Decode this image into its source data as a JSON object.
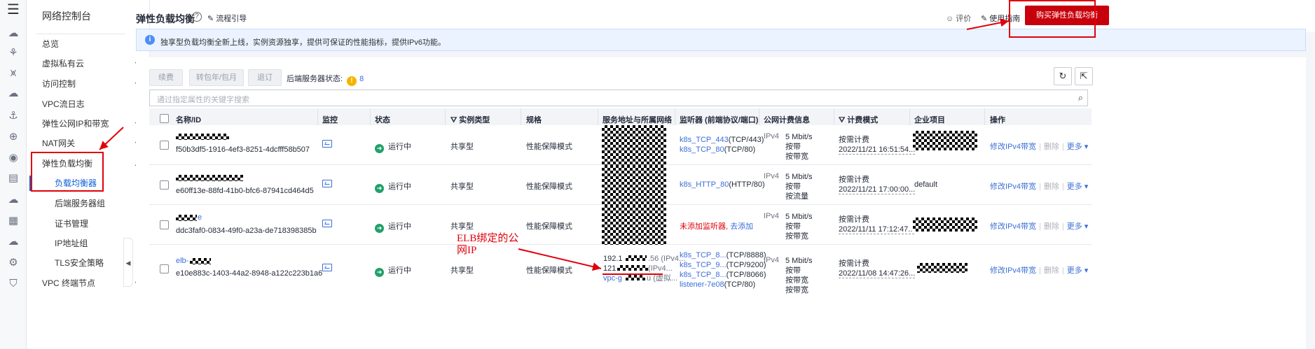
{
  "rail": {
    "icons": [
      "menu-icon",
      "cloud-icon",
      "cluster-icon",
      "bridge-icon",
      "cloud-network-icon",
      "anchor-icon",
      "globe-icon",
      "target-icon",
      "document-icon",
      "cloud-outline-icon",
      "server-icon",
      "cloud-link-icon",
      "gear-box-icon"
    ]
  },
  "sidebar": {
    "title": "网络控制台",
    "items": [
      {
        "label": "总览",
        "caret": ""
      },
      {
        "label": "虚拟私有云",
        "caret": "▼"
      },
      {
        "label": "访问控制",
        "caret": "▼"
      },
      {
        "label": "VPC流日志",
        "caret": ""
      },
      {
        "label": "弹性公网IP和带宽",
        "caret": "▼"
      },
      {
        "label": "NAT网关",
        "caret": "▼"
      },
      {
        "label": "弹性负载均衡",
        "caret": "▲"
      }
    ],
    "subitems": [
      "负载均衡器",
      "后端服务器组",
      "证书管理",
      "IP地址组",
      "TLS安全策略"
    ],
    "bottom_item": {
      "label": "VPC 终端节点",
      "caret": "▼"
    },
    "collapse": "◀"
  },
  "header": {
    "title": "弹性负载均衡",
    "help": "?",
    "flow_guide": "流程引导",
    "rate": "评价",
    "usage_guide": "使用指南",
    "buy_button": "购买弹性负载均衡"
  },
  "notice": {
    "icon": "i",
    "text": "独享型负载均衡全新上线，实例资源独享，提供可保证的性能指标，提供IPv6功能。"
  },
  "toolbar": {
    "renew": "续费",
    "to_monthly": "转包年/包月",
    "unsubscribe": "退订",
    "backend_status_label": "后端服务器状态:",
    "backend_status_icon": "!",
    "backend_status_count": "8",
    "refresh_icon": "↻",
    "export_icon": "⇱"
  },
  "search": {
    "placeholder": "通过指定属性的关键字搜索",
    "icon": "⌕"
  },
  "table": {
    "headers": {
      "name": "名称/ID",
      "monitor": "监控",
      "status": "状态",
      "instance_type": "实例类型",
      "spec": "规格",
      "service_addr": "服务地址与所属网络",
      "listener": "监听器 (前端协议/端口)",
      "billing_info": "公网计费信息",
      "billing_mode": "计费模式",
      "enterprise_project": "企业项目",
      "operation": "操作"
    },
    "rows": [
      {
        "name_suffix": "",
        "id": "f50b3df5-1916-4ef3-8251-4dcfff58b507",
        "status": "运行中",
        "type": "共享型",
        "spec": "性能保障模式",
        "addr": [
          "",
          "",
          ""
        ],
        "listeners": [
          {
            "name": "k8s_TCP_443",
            "proto": "(TCP/443)"
          },
          {
            "name": "k8s_TCP_80",
            "proto": "(TCP/80)"
          }
        ],
        "listener_empty": "",
        "listener_add": "",
        "ip_type": "IPv4",
        "bandwidth": "5 Mbit/s",
        "bw_line2": "按带",
        "bw_line3": "按带宽",
        "bw_line4": "",
        "billing": "按需计费",
        "billing_date": "2022/11/21 16:51:54...",
        "project": "",
        "op_modify": "修改IPv4带宽",
        "op_delete": "删除",
        "op_more": "更多"
      },
      {
        "name_suffix": "",
        "id": "e60ff13e-88fd-41b0-bfc6-87941cd464d5",
        "status": "运行中",
        "type": "共享型",
        "spec": "性能保障模式",
        "addr": [
          "",
          "",
          ""
        ],
        "listeners": [
          {
            "name": "k8s_HTTP_80",
            "proto": "(HTTP/80)"
          }
        ],
        "listener_empty": "",
        "listener_add": "",
        "ip_type": "IPv4",
        "bandwidth": "5 Mbit/s",
        "bw_line2": "按带",
        "bw_line3": "按流量",
        "bw_line4": "",
        "billing": "按需计费",
        "billing_date": "2022/11/21 17:00:00...",
        "project": "default",
        "op_modify": "修改IPv4带宽",
        "op_delete": "删除",
        "op_more": "更多"
      },
      {
        "name_suffix": "e",
        "id": "ddc3faf0-0834-49f0-a23a-de718398385b",
        "status": "运行中",
        "type": "共享型",
        "spec": "性能保障模式",
        "addr": [
          "",
          "",
          ""
        ],
        "listeners": [],
        "listener_empty": "未添加监听器,",
        "listener_add": "去添加",
        "ip_type": "IPv4",
        "bandwidth": "5 Mbit/s",
        "bw_line2": "按带",
        "bw_line3": "按带宽",
        "bw_line4": "",
        "billing": "按需计费",
        "billing_date": "2022/11/11 17:12:47...",
        "project": "",
        "op_modify": "修改IPv4带宽",
        "op_delete": "删除",
        "op_more": "更多"
      },
      {
        "name_suffix": "elb-",
        "id": "e10e883c-1403-44a2-8948-a122c223b1a6",
        "status": "运行中",
        "type": "共享型",
        "spec": "性能保障模式",
        "addr": [
          "192.1",
          "121",
          "vpc-g"
        ],
        "addr_tail": [
          ".56 (IPv4...",
          "(IPv4...",
          "u (虚拟..."
        ],
        "listeners": [
          {
            "name": "k8s_TCP_8...",
            "proto": "(TCP/8888)"
          },
          {
            "name": "k8s_TCP_9...",
            "proto": "(TCP/9200)"
          },
          {
            "name": "k8s_TCP_8...",
            "proto": "(TCP/8066)"
          },
          {
            "name": "listener-7e08",
            "proto": "(TCP/80)"
          }
        ],
        "listener_empty": "",
        "listener_add": "",
        "ip_type": "IPv4",
        "bandwidth": "5 Mbit/s",
        "bw_line2": "按带",
        "bw_line3": "按带宽",
        "bw_line4": "按带宽",
        "billing": "按需计费",
        "billing_date": "2022/11/08 14:47:26...",
        "project": "",
        "op_modify": "修改IPv4带宽",
        "op_delete": "删除",
        "op_more": "更多"
      }
    ]
  },
  "annotations": {
    "elb_note": "ELB绑定的公网IP"
  },
  "colors": {
    "accent": "#0b5fd6",
    "link": "#3b6fd8",
    "buy": "#c7000b",
    "annotation": "#e0000a",
    "running": "#22a06b",
    "warning": "#f5b300"
  }
}
